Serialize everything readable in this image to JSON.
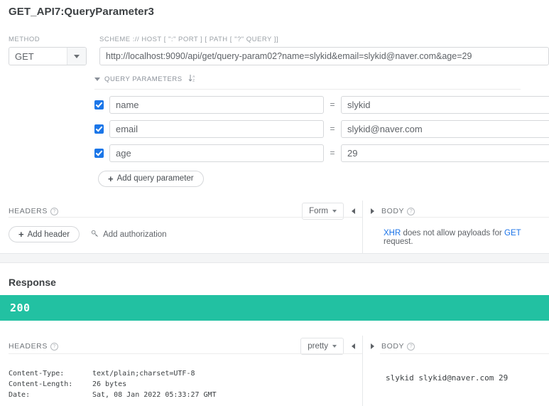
{
  "request": {
    "title": "GET_API7:QueryParameter3",
    "method_label": "METHOD",
    "method_value": "GET",
    "url_label": "SCHEME :// HOST [ \":\" PORT ] [ PATH [ \"?\" QUERY ]]",
    "url_value": "http://localhost:9090/api/get/query-param02?name=slykid&email=slykid@naver.com&age=29",
    "query_parameters": {
      "section_label": "QUERY PARAMETERS",
      "sort_icon": "sort-az-icon",
      "equals_sign": "=",
      "rows": [
        {
          "enabled": true,
          "key": "name",
          "value": "slykid"
        },
        {
          "enabled": true,
          "key": "email",
          "value": "slykid@naver.com"
        },
        {
          "enabled": true,
          "key": "age",
          "value": "29"
        }
      ],
      "add_button": "Add query parameter",
      "add_button_icon": "plus-icon"
    },
    "headers": {
      "section_label": "HEADERS",
      "help_icon": "help-circle-icon",
      "format_select": "Form",
      "collapse_left_icon": "triangle-left-icon",
      "collapse_right_icon": "triangle-right-icon",
      "add_header_button": "Add header",
      "add_header_icon": "plus-icon",
      "add_authorization": "Add authorization",
      "add_authorization_icon": "key-icon"
    },
    "body": {
      "section_label": "BODY",
      "help_icon": "help-circle-icon",
      "note_prefix": "XHR",
      "note_middle": " does not allow payloads for ",
      "note_method": "GET",
      "note_suffix": " request."
    }
  },
  "response": {
    "title": "Response",
    "status_code": "200",
    "status_color": "#22c1a2",
    "headers": {
      "section_label": "HEADERS",
      "help_icon": "help-circle-icon",
      "format_select": "pretty",
      "collapse_left_icon": "triangle-left-icon",
      "collapse_right_icon": "triangle-right-icon",
      "rows": [
        {
          "key": "Content-Type:",
          "value": "text/plain;charset=UTF-8"
        },
        {
          "key": "Content-Length:",
          "value": "26 bytes"
        },
        {
          "key": "Date:",
          "value": "Sat, 08 Jan 2022 05:33:27 GMT"
        }
      ]
    },
    "body": {
      "section_label": "BODY",
      "help_icon": "help-circle-icon",
      "content": "slykid slykid@naver.com 29"
    }
  },
  "colors": {
    "accent_teal": "#22c1a2",
    "checkbox_blue": "#1b76e8",
    "link_blue": "#1a73e8",
    "border_gray": "#d6d8db"
  }
}
